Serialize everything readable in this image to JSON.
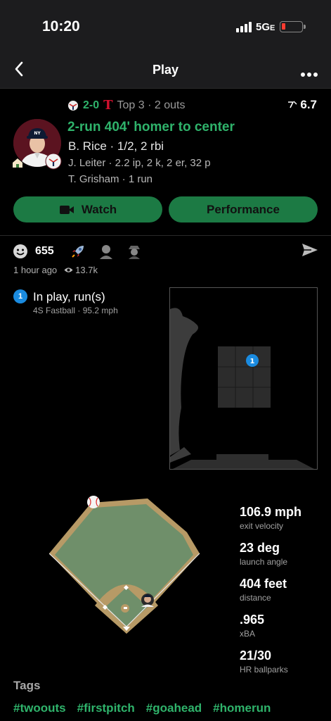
{
  "status": {
    "time": "10:20",
    "network": "5G",
    "network_suffix": "E"
  },
  "nav": {
    "title": "Play",
    "back_icon": "chevron-left-icon",
    "more_icon": "ellipsis-icon"
  },
  "play": {
    "score": "2-0",
    "inning": "Top 3 · 2 outs",
    "rating": "6.7",
    "headline": "2-run 404' homer to center",
    "batter": "B. Rice · 1/2, 2 rbi",
    "pitcher": "J. Leiter · 2.2 ip, 2 k, 2 er, 32 p",
    "runner": "T. Grisham · 1 run",
    "team_home_letter": "T",
    "buttons": {
      "watch": "Watch",
      "performance": "Performance"
    }
  },
  "reactions": {
    "count": "655",
    "time_ago": "1 hour ago",
    "views": "13.7k"
  },
  "pitch": {
    "number": "1",
    "result": "In play, run(s)",
    "type": "4S Fastball",
    "speed": "95.2 mph",
    "zone_label": "1"
  },
  "stats": [
    {
      "value": "106.9 mph",
      "label": "exit velocity"
    },
    {
      "value": "23 deg",
      "label": "launch angle"
    },
    {
      "value": "404 feet",
      "label": "distance"
    },
    {
      "value": ".965",
      "label": "xBA"
    },
    {
      "value": "21/30",
      "label": "HR ballparks"
    }
  ],
  "tags": {
    "header": "Tags",
    "items": [
      "#twoouts",
      "#firstpitch",
      "#goahead",
      "#homerun"
    ]
  },
  "colors": {
    "accent": "#2fb36b",
    "button": "#1c7a44",
    "pitch_dot": "#1a8be0",
    "field_grass": "#6f8f6a",
    "field_dirt": "#b79a66"
  }
}
